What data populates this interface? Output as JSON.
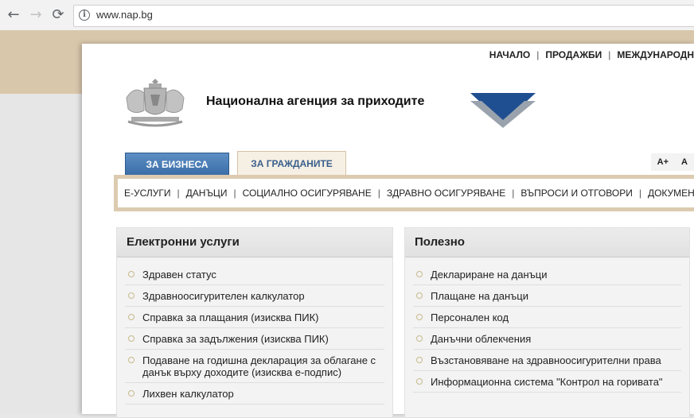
{
  "browser": {
    "url": "www.nap.bg",
    "back_icon": "←",
    "forward_icon": "→",
    "reload_icon": "⟳"
  },
  "header": {
    "top_nav": [
      "НАЧАЛО",
      "ПРОДАЖБИ",
      "МЕЖДУНАРОДН"
    ],
    "agency_title": "Национална агенция за приходите",
    "font_controls": [
      "A+",
      "A"
    ]
  },
  "tabs": {
    "business": "ЗА БИЗНЕСА",
    "citizens": "ЗА ГРАЖДАНИТЕ"
  },
  "menu": [
    "Е-УСЛУГИ",
    "ДАНЪЦИ",
    "СОЦИАЛНО ОСИГУРЯВАНЕ",
    "ЗДРАВНО ОСИГУРЯВАНЕ",
    "ВЪПРОСИ И ОТГОВОРИ",
    "ДОКУМЕНТИ"
  ],
  "panels": {
    "electronic": {
      "title": "Електронни услуги",
      "items": [
        "Здравен статус",
        "Здравноосигурителен калкулатор",
        "Справка за плащания (изисква ПИК)",
        "Справка за задължения (изисква ПИК)",
        "Подаване на годишна декларация за облагане с данък върху доходите (изисква е-подпис)",
        "Лихвен калкулатор"
      ]
    },
    "useful": {
      "title": "Полезно",
      "items": [
        "Деклариране на данъци",
        "Плащане на данъци",
        "Персонален код",
        "Данъчни облекчения",
        "Възстановяване на здравноосигурителни права",
        "Информационна система \"Контрол на горивата\""
      ]
    }
  },
  "colors": {
    "accent_blue": "#3a6ea8",
    "beige": "#d9c7ab"
  }
}
